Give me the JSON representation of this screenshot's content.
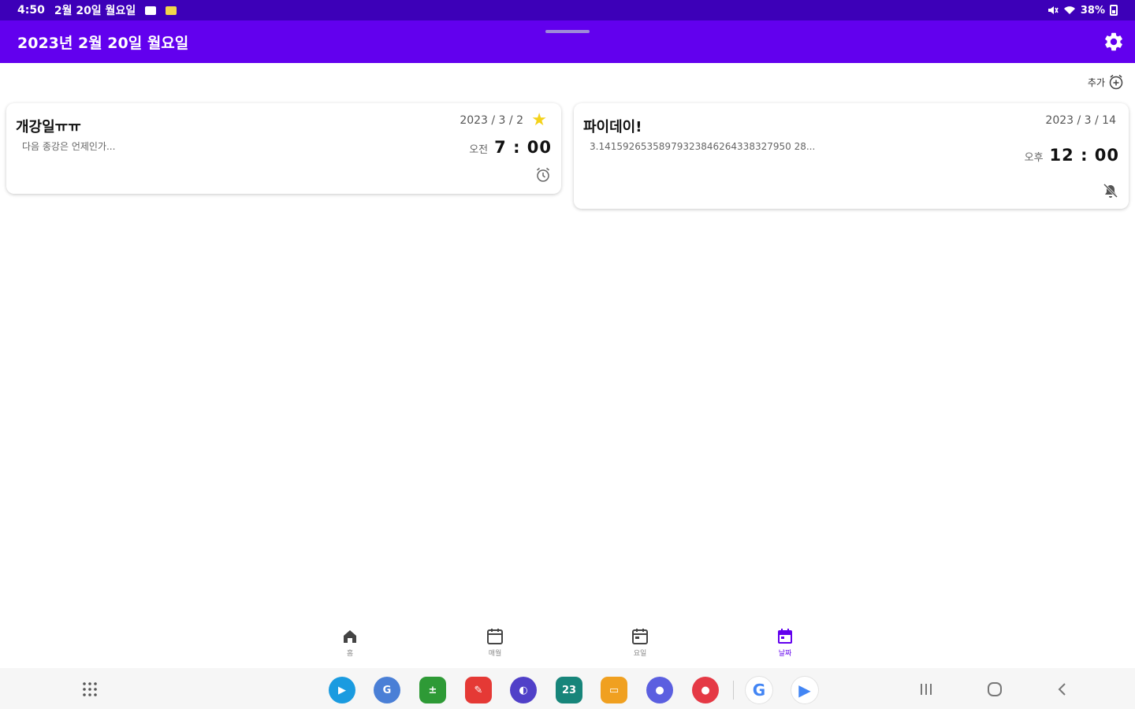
{
  "status_bar": {
    "time": "4:50",
    "date": "2월 20일 월요일",
    "battery": "38%"
  },
  "app_bar": {
    "title": "2023년 2월 20일 월요일",
    "settings_icon": "gear-icon"
  },
  "add_button": {
    "label": "추가",
    "icon": "add-alarm-icon"
  },
  "cards": [
    {
      "title": "개강일ㅠㅠ",
      "description": "다음 종강은 언제인가...",
      "date": "2023 / 3 / 2",
      "starred": true,
      "ampm": "오전",
      "time": "7 : 00",
      "alarm_icon": "alarm-clock-icon"
    },
    {
      "title": "파이데이!",
      "description": "3.14159265358979323846264338327950 28...",
      "date": "2023 / 3 / 14",
      "starred": false,
      "ampm": "오후",
      "time": "12 : 00",
      "alarm_icon": "alarm-off-icon"
    }
  ],
  "bottom_nav": {
    "items": [
      {
        "label": "홈",
        "icon": "home-icon"
      },
      {
        "label": "매월",
        "icon": "calendar-month-icon"
      },
      {
        "label": "요일",
        "icon": "calendar-week-icon"
      },
      {
        "label": "날짜",
        "icon": "calendar-date-icon"
      }
    ],
    "active_index": 3,
    "active_color": "#6200ee"
  },
  "taskbar": {
    "apps": [
      {
        "name": "play-store-icon",
        "glyph": "▶",
        "color": "#1a9be0"
      },
      {
        "name": "translate-icon",
        "glyph": "G",
        "color": "#4a7fd6"
      },
      {
        "name": "calculator-icon",
        "glyph": "±",
        "color": "#2e9a36"
      },
      {
        "name": "notes-icon",
        "glyph": "✎",
        "color": "#e53935"
      },
      {
        "name": "browser-icon",
        "glyph": "◐",
        "color": "#5040c8"
      },
      {
        "name": "calendar-app-icon",
        "glyph": "23",
        "color": "#17857a"
      },
      {
        "name": "files-icon",
        "glyph": "▭",
        "color": "#f0a020"
      },
      {
        "name": "chat-icon",
        "glyph": "●",
        "color": "#5b5fe0"
      },
      {
        "name": "recorder-icon",
        "glyph": "●",
        "color": "#e53945"
      },
      {
        "name": "google-icon",
        "glyph": "G",
        "color": "#ffffff"
      },
      {
        "name": "play-games-icon",
        "glyph": "▶",
        "color": "#ffffff"
      }
    ]
  }
}
